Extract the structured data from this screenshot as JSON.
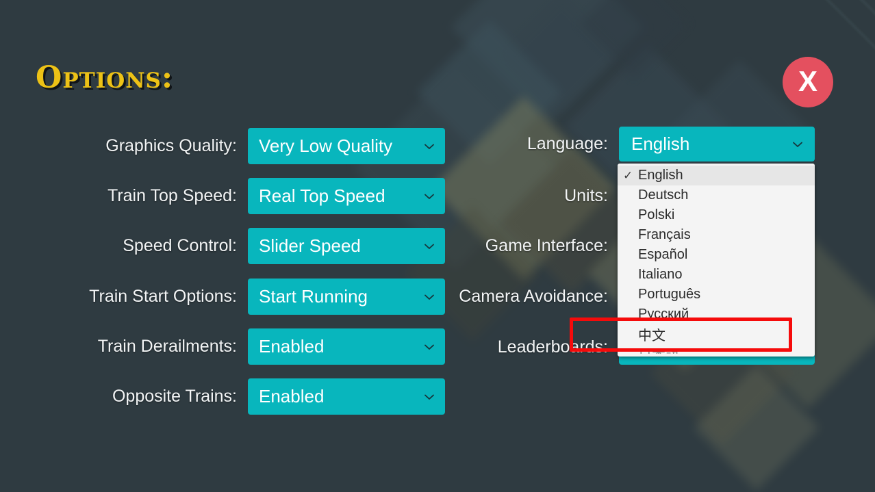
{
  "window": {
    "title": "Options:",
    "background_color": "#2e3a40",
    "accent_color": "#08b6bd",
    "title_color": "#edc216"
  },
  "close_button": {
    "label": "X",
    "name": "close-button",
    "color": "#e4505f"
  },
  "left_column": [
    {
      "label": "Graphics Quality:",
      "value": "Very Low Quality"
    },
    {
      "label": "Train Top Speed:",
      "value": "Real Top Speed"
    },
    {
      "label": "Speed Control:",
      "value": "Slider Speed"
    },
    {
      "label": "Train Start Options:",
      "value": "Start Running"
    },
    {
      "label": "Train Derailments:",
      "value": "Enabled"
    },
    {
      "label": "Opposite Trains:",
      "value": "Enabled"
    }
  ],
  "right_column": [
    {
      "label": "Language:",
      "value": "English"
    },
    {
      "label": "Units:",
      "value": ""
    },
    {
      "label": "Game Interface:",
      "value": ""
    },
    {
      "label": "Camera Avoidance:",
      "value": ""
    },
    {
      "label": "Leaderboards:",
      "value": ""
    }
  ],
  "language_dropdown": {
    "open": true,
    "selected": "English",
    "check_glyph": "✓",
    "options": [
      "English",
      "Deutsch",
      "Polski",
      "Français",
      "Español",
      "Italiano",
      "Português",
      "Русский",
      "中文",
      "日本語"
    ]
  },
  "annotation": {
    "type": "red-rectangle",
    "target": "中文",
    "color": "#f50b0b"
  }
}
